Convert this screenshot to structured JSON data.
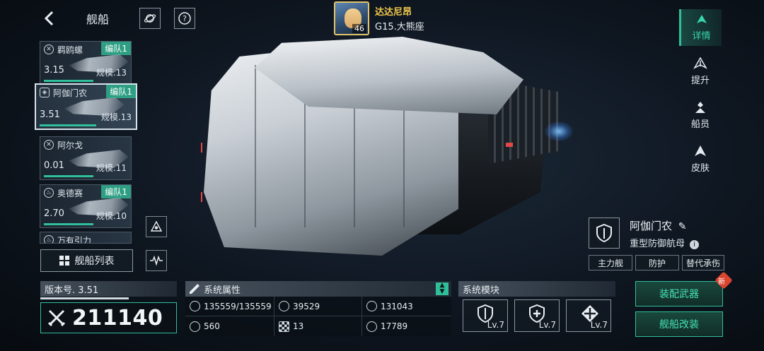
{
  "header": {
    "title": "舰船",
    "commander": {
      "name": "达达尼昂",
      "location": "G15.大熊座",
      "level": "46"
    }
  },
  "ship_list": [
    {
      "name": "羁鸥螺",
      "fleet": "编队1",
      "version": "3.15",
      "scale": "规模.13",
      "selected": false,
      "class_icon": "x-circle-icon"
    },
    {
      "name": "阿伽门农",
      "fleet": "编队1",
      "version": "3.51",
      "scale": "规模.13",
      "selected": true,
      "class_icon": "shield-icon"
    },
    {
      "name": "阿尔戈",
      "fleet": "",
      "version": "0.01",
      "scale": "规模.11",
      "selected": false,
      "class_icon": "x-circle-icon"
    },
    {
      "name": "奥德赛",
      "fleet": "编队1",
      "version": "2.70",
      "scale": "规模.10",
      "selected": false,
      "class_icon": "flame-icon"
    },
    {
      "name": "万有引力",
      "fleet": "",
      "version": "",
      "scale": "",
      "selected": false,
      "class_icon": "flame-icon"
    }
  ],
  "ship_list_button": "舰船列表",
  "right_tabs": [
    {
      "label": "详情",
      "active": true
    },
    {
      "label": "提升",
      "active": false
    },
    {
      "label": "船员",
      "active": false
    },
    {
      "label": "皮肤",
      "active": false
    }
  ],
  "ship": {
    "name": "阿伽门农",
    "type": "重型防御航母",
    "tags": [
      "主力舰",
      "防护",
      "替代承伤"
    ]
  },
  "version": {
    "label": "版本号. 3.51",
    "power": "211140"
  },
  "attributes": {
    "title": "系统属性",
    "items": [
      {
        "value": "135559/135559",
        "icon": "hull-icon"
      },
      {
        "value": "39529",
        "icon": "armor-icon"
      },
      {
        "value": "131043",
        "icon": "shield-stat-icon"
      },
      {
        "value": "560",
        "icon": "speed-icon"
      },
      {
        "value": "13",
        "icon": "grid-icon"
      },
      {
        "value": "17789",
        "icon": "target-icon"
      }
    ]
  },
  "modules": {
    "title": "系统模块",
    "items": [
      {
        "level": "Lv.7",
        "icon": "shield-module-icon"
      },
      {
        "level": "Lv.7",
        "icon": "repair-module-icon"
      },
      {
        "level": "Lv.7",
        "icon": "cross-module-icon"
      }
    ]
  },
  "actions": {
    "equip": "装配武器",
    "modify": "舰船改装",
    "new_badge": "新"
  },
  "colors": {
    "accent": "#2fbf9a",
    "gold": "#f2c94c",
    "alert": "#d9452f"
  }
}
